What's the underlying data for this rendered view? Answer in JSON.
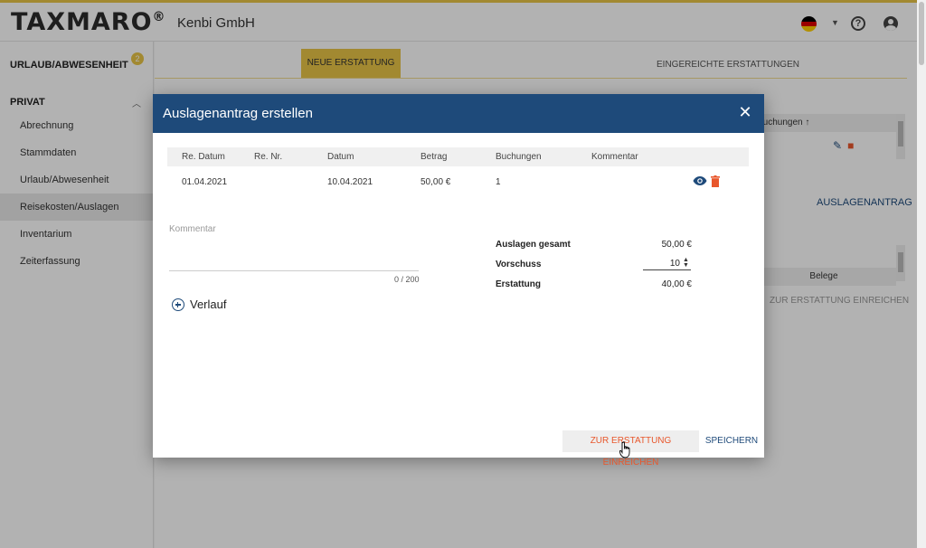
{
  "brand": {
    "logo": "TAXMARO",
    "registered": "®"
  },
  "header": {
    "company": "Kenbi GmbH",
    "help_glyph": "?"
  },
  "sidebar": {
    "section1": {
      "label": "URLAUB/ABWESENHEIT",
      "badge": "2"
    },
    "section2": {
      "label": "PRIVAT"
    },
    "items": [
      {
        "label": "Abrechnung"
      },
      {
        "label": "Stammdaten"
      },
      {
        "label": "Urlaub/Abwesenheit"
      },
      {
        "label": "Reisekosten/Auslagen",
        "active": true
      },
      {
        "label": "Inventarium"
      },
      {
        "label": "Zeiterfassung"
      }
    ]
  },
  "main": {
    "tabs": [
      {
        "label": "NEUE ERSTATTUNG",
        "active": true
      },
      {
        "label": "EINGEREICHTE ERSTATTUNGEN",
        "active": false
      }
    ],
    "bg_header": "Buchungen",
    "bg_antrag": "AUSLAGENANTRAG",
    "bg_belege": "Belege",
    "bg_submit": "ZUR ERSTATTUNG EINREICHEN"
  },
  "modal": {
    "title": "Auslagenantrag erstellen",
    "columns": [
      "Re. Datum",
      "Re. Nr.",
      "Datum",
      "Betrag",
      "Buchungen",
      "Kommentar"
    ],
    "rows": [
      {
        "re_datum": "01.04.2021",
        "re_nr": "",
        "datum": "10.04.2021",
        "betrag": "50,00 €",
        "buchungen": "1",
        "kommentar": ""
      }
    ],
    "comment": {
      "placeholder": "Kommentar",
      "value": "",
      "counter": "0 / 200"
    },
    "summary": {
      "auslagen_label": "Auslagen gesamt",
      "auslagen_value": "50,00 €",
      "vorschuss_label": "Vorschuss",
      "vorschuss_value": "10",
      "erstattung_label": "Erstattung",
      "erstattung_value": "40,00 €"
    },
    "verlauf_label": "Verlauf",
    "submit_label": "ZUR ERSTATTUNG EINREICHEN",
    "save_label": "SPEICHERN"
  },
  "colors": {
    "accent_yellow": "#e8c547",
    "modal_header": "#1e4a7a",
    "danger": "#e8572c"
  }
}
